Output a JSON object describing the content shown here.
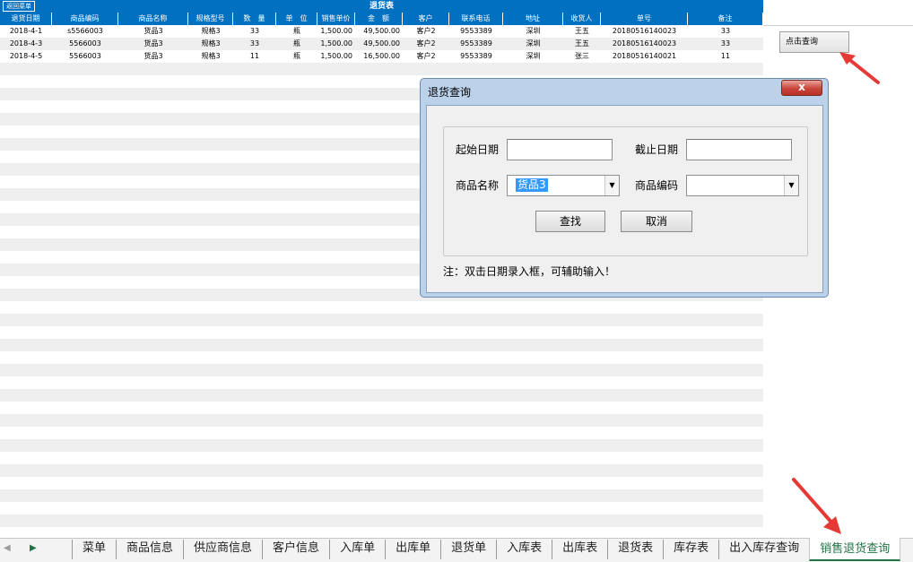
{
  "sheet": {
    "title": "退货表",
    "return_label": "返回菜单",
    "columns": [
      "退货日期",
      "商品编码",
      "商品名称",
      "规格型号",
      "数　量",
      "单　位",
      "销售单价",
      "金　额",
      "客户",
      "联系电话",
      "地址",
      "收货人",
      "单号",
      "备注"
    ],
    "rows": [
      [
        "2018-4-1",
        "s5566003",
        "货品3",
        "规格3",
        "33",
        "瓶",
        "1,500.00",
        "49,500.00",
        "客户2",
        "9553389",
        "深圳",
        "王五",
        "20180516140023",
        "33"
      ],
      [
        "2018-4-3",
        "5566003",
        "货品3",
        "规格3",
        "33",
        "瓶",
        "1,500.00",
        "49,500.00",
        "客户2",
        "9553389",
        "深圳",
        "王五",
        "20180516140023",
        "33"
      ],
      [
        "2018-4-5",
        "5566003",
        "货品3",
        "规格3",
        "11",
        "瓶",
        "1,500.00",
        "16,500.00",
        "客户2",
        "9553389",
        "深圳",
        "张三",
        "20180516140021",
        "11"
      ]
    ],
    "query_button": "点击查询"
  },
  "dialog": {
    "title": "退货查询",
    "close_label": "x",
    "start_date_label": "起始日期",
    "start_date_value": "",
    "end_date_label": "截止日期",
    "end_date_value": "",
    "product_name_label": "商品名称",
    "product_name_value": "货品3",
    "product_code_label": "商品编码",
    "product_code_value": "",
    "find_button": "查找",
    "cancel_button": "取消",
    "note": "注：双击日期录入框，可辅助输入！"
  },
  "tabbar": {
    "nav_prev": "◀",
    "nav_next": "▶",
    "tabs": [
      "菜单",
      "商品信息",
      "供应商信息",
      "客户信息",
      "入库单",
      "出库单",
      "退货单",
      "入库表",
      "出库表",
      "退货表",
      "库存表",
      "出入库存查询",
      "销售退货查询"
    ],
    "active_index": 12
  },
  "colors": {
    "header_blue": "#0070c0",
    "stripe_gray": "#efefef",
    "excel_green": "#217346",
    "arrow_red": "#e53935"
  }
}
